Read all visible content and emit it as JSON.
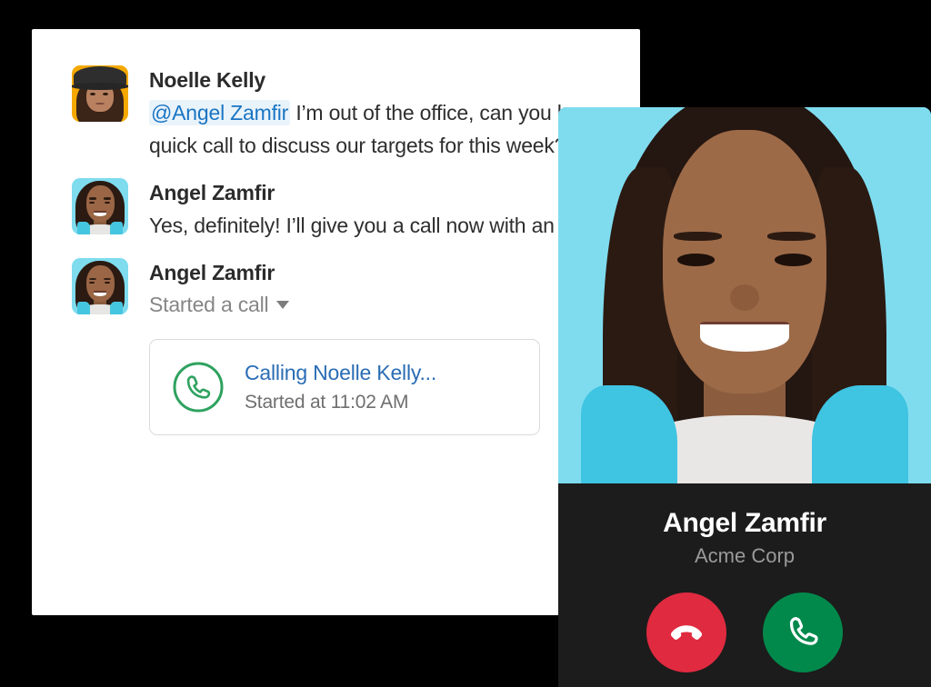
{
  "theme": {
    "page_background": "#000000",
    "card_background": "#ffffff",
    "panel_background": "#1c1c1c",
    "mention_text": "#1a75c4",
    "mention_background": "#e9f3fa",
    "link_blue": "#2a6db5",
    "accept_green": "#01894c",
    "decline_red": "#e02a40",
    "call_icon_green": "#2ea25f",
    "photo_background": "#7fdcef"
  },
  "conversation": {
    "messages": [
      {
        "author": "Noelle Kelly",
        "avatar_name": "avatar-noelle-kelly",
        "mention": "@Angel Zamfir",
        "text": " I’m out of the office, can you hop on a quick call to discuss our targets for this week?"
      },
      {
        "author": "Angel Zamfir",
        "avatar_name": "avatar-angel-zamfir",
        "text": "Yes, definitely! I’ll give you a call now with an update."
      },
      {
        "author": "Angel Zamfir",
        "avatar_name": "avatar-angel-zamfir",
        "status": "Started a call",
        "status_chevron": "chevron-down-icon"
      }
    ]
  },
  "call_attachment": {
    "icon": "phone-outline-icon",
    "title": "Calling Noelle Kelly...",
    "subtitle": "Started at 11:02 AM"
  },
  "call_panel": {
    "photo_name": "caller-photo-angel-zamfir",
    "caller_name": "Angel Zamfir",
    "organization": "Acme Corp",
    "buttons": [
      {
        "name": "decline-call-button",
        "icon": "phone-hangup-icon",
        "label": "Decline",
        "color": "#e02a40"
      },
      {
        "name": "accept-call-button",
        "icon": "phone-icon",
        "label": "Accept",
        "color": "#01894c"
      }
    ]
  }
}
